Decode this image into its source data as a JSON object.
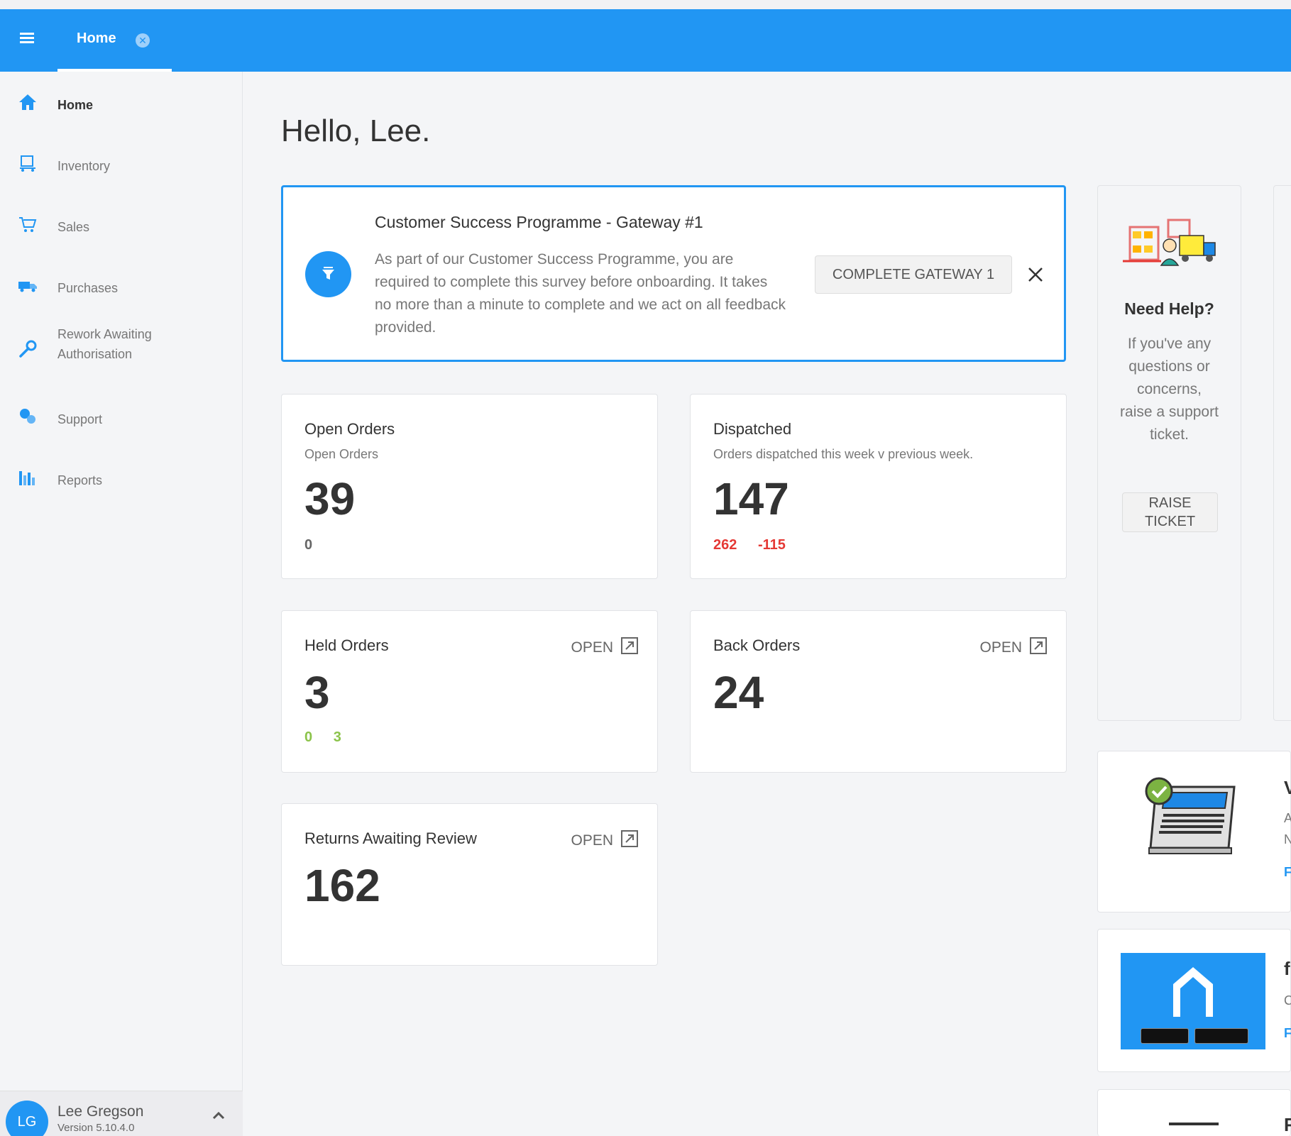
{
  "app": {
    "tabs": [
      {
        "label": "Home"
      }
    ]
  },
  "sidebar": {
    "items": [
      {
        "label": "Home",
        "icon": "home-icon"
      },
      {
        "label": "Inventory",
        "icon": "hand-truck-icon"
      },
      {
        "label": "Sales",
        "icon": "cart-icon"
      },
      {
        "label": "Purchases",
        "icon": "truck-icon"
      },
      {
        "label": "Rework Awaiting",
        "label2": "Authorisation",
        "icon": "wrench-icon"
      },
      {
        "label": "Support",
        "icon": "chat-icon"
      },
      {
        "label": "Reports",
        "icon": "bar-chart-icon"
      }
    ],
    "user": {
      "initials": "LG",
      "name": "Lee Gregson",
      "version": "Version 5.10.4.0"
    }
  },
  "main": {
    "greeting": "Hello, Lee.",
    "banner": {
      "title": "Customer Success Programme - Gateway #1",
      "text": "As part of our Customer Success Programme, you are required to complete this survey before onboarding. It takes no more than a minute to complete and we act on all feedback provided.",
      "button": "COMPLETE GATEWAY 1"
    },
    "cards": {
      "open_orders": {
        "title": "Open Orders",
        "subtitle": "Open Orders",
        "value": "39",
        "metric1": "0"
      },
      "dispatched": {
        "title": "Dispatched",
        "subtitle": "Orders dispatched this week v previous week.",
        "value": "147",
        "metric1": "262",
        "metric2": "-115"
      },
      "held_orders": {
        "title": "Held Orders",
        "open": "OPEN",
        "value": "3",
        "metric1": "0",
        "metric2": "3"
      },
      "back_orders": {
        "title": "Back Orders",
        "open": "OPEN",
        "value": "24"
      },
      "returns": {
        "title": "Returns Awaiting Review",
        "open": "OPEN",
        "value": "162"
      }
    },
    "help": {
      "title": "Need Help?",
      "text": "If you've any questions or concerns, raise a support ticket.",
      "button_line1": "RAISE",
      "button_line2": "TICKET"
    },
    "side_cut": {
      "c1": "V",
      "c2": "A",
      "c3": "N",
      "c4": "F",
      "c5": "f",
      "c6": "C",
      "c7": "F",
      "c8": "F"
    }
  },
  "colors": {
    "accent": "#2196f3",
    "negative": "#e53935",
    "positive": "#8bc34a",
    "dark": "#333333"
  }
}
